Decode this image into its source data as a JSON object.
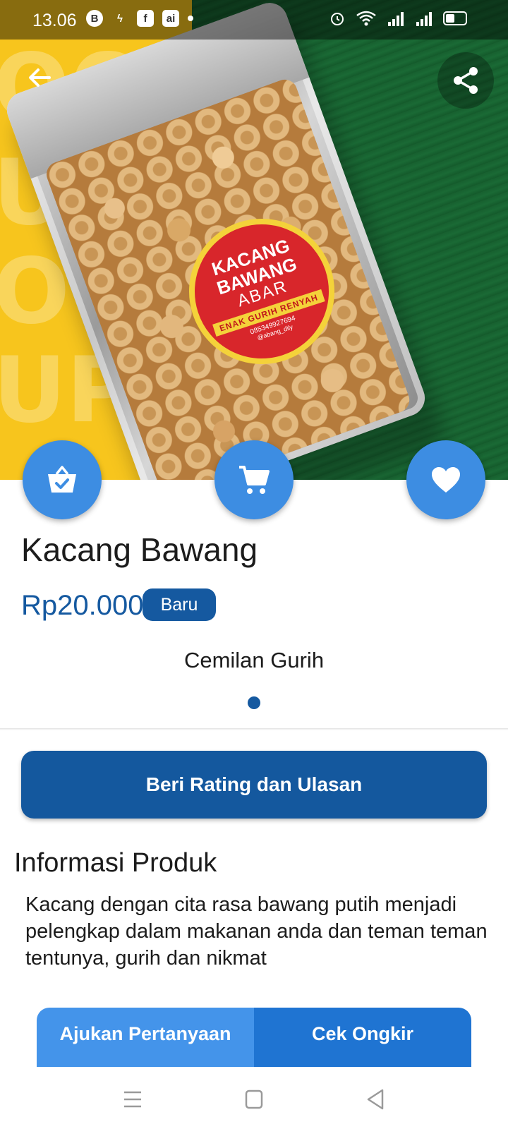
{
  "status_bar": {
    "time": "13.06",
    "left_icons": [
      "b-circle-icon",
      "messenger-icon",
      "facebook-icon",
      "ai-icon",
      "dot-icon"
    ],
    "right_icons": [
      "alarm-icon",
      "wifi-icon",
      "signal-icon",
      "signal-icon",
      "battery-icon"
    ]
  },
  "hero": {
    "background_words": [
      "OOD",
      "UPER",
      "OOD",
      "UPER"
    ],
    "package_label": {
      "line1": "KACANG",
      "line2": "BAWANG",
      "line3": "ABAR",
      "tagline": "ENAK GURIH RENYAH",
      "phone": "085349927694",
      "handle": "@abang_dily"
    },
    "colors": {
      "left_panel": "#f7c51d",
      "right_panel": "#17602f",
      "label": "#d8262b"
    }
  },
  "actions": {
    "back_icon": "arrow-left-icon",
    "share_icon": "share-icon",
    "fab_basket_icon": "basket-check-icon",
    "fab_cart_icon": "cart-icon",
    "fab_favorite_icon": "heart-icon"
  },
  "product": {
    "name": "Kacang Bawang",
    "price": "Rp20.000",
    "condition_badge": "Baru",
    "category": "Cemilan Gurih"
  },
  "rating_button": "Beri Rating dan Ulasan",
  "info": {
    "title": "Informasi Produk",
    "description": "Kacang dengan cita rasa bawang putih menjadi pelengkap dalam makanan anda dan teman teman tentunya, gurih dan nikmat"
  },
  "bottom_buttons": {
    "ask": "Ajukan Pertanyaan",
    "shipping": "Cek Ongkir"
  },
  "nav": {
    "menu_icon": "menu-icon",
    "home_icon": "square-home-icon",
    "back_icon": "triangle-back-icon"
  },
  "colors": {
    "primary": "#14589e",
    "fab": "#3d8de2",
    "ask_button": "#4494ea",
    "shipping_button": "#1f74d2"
  }
}
